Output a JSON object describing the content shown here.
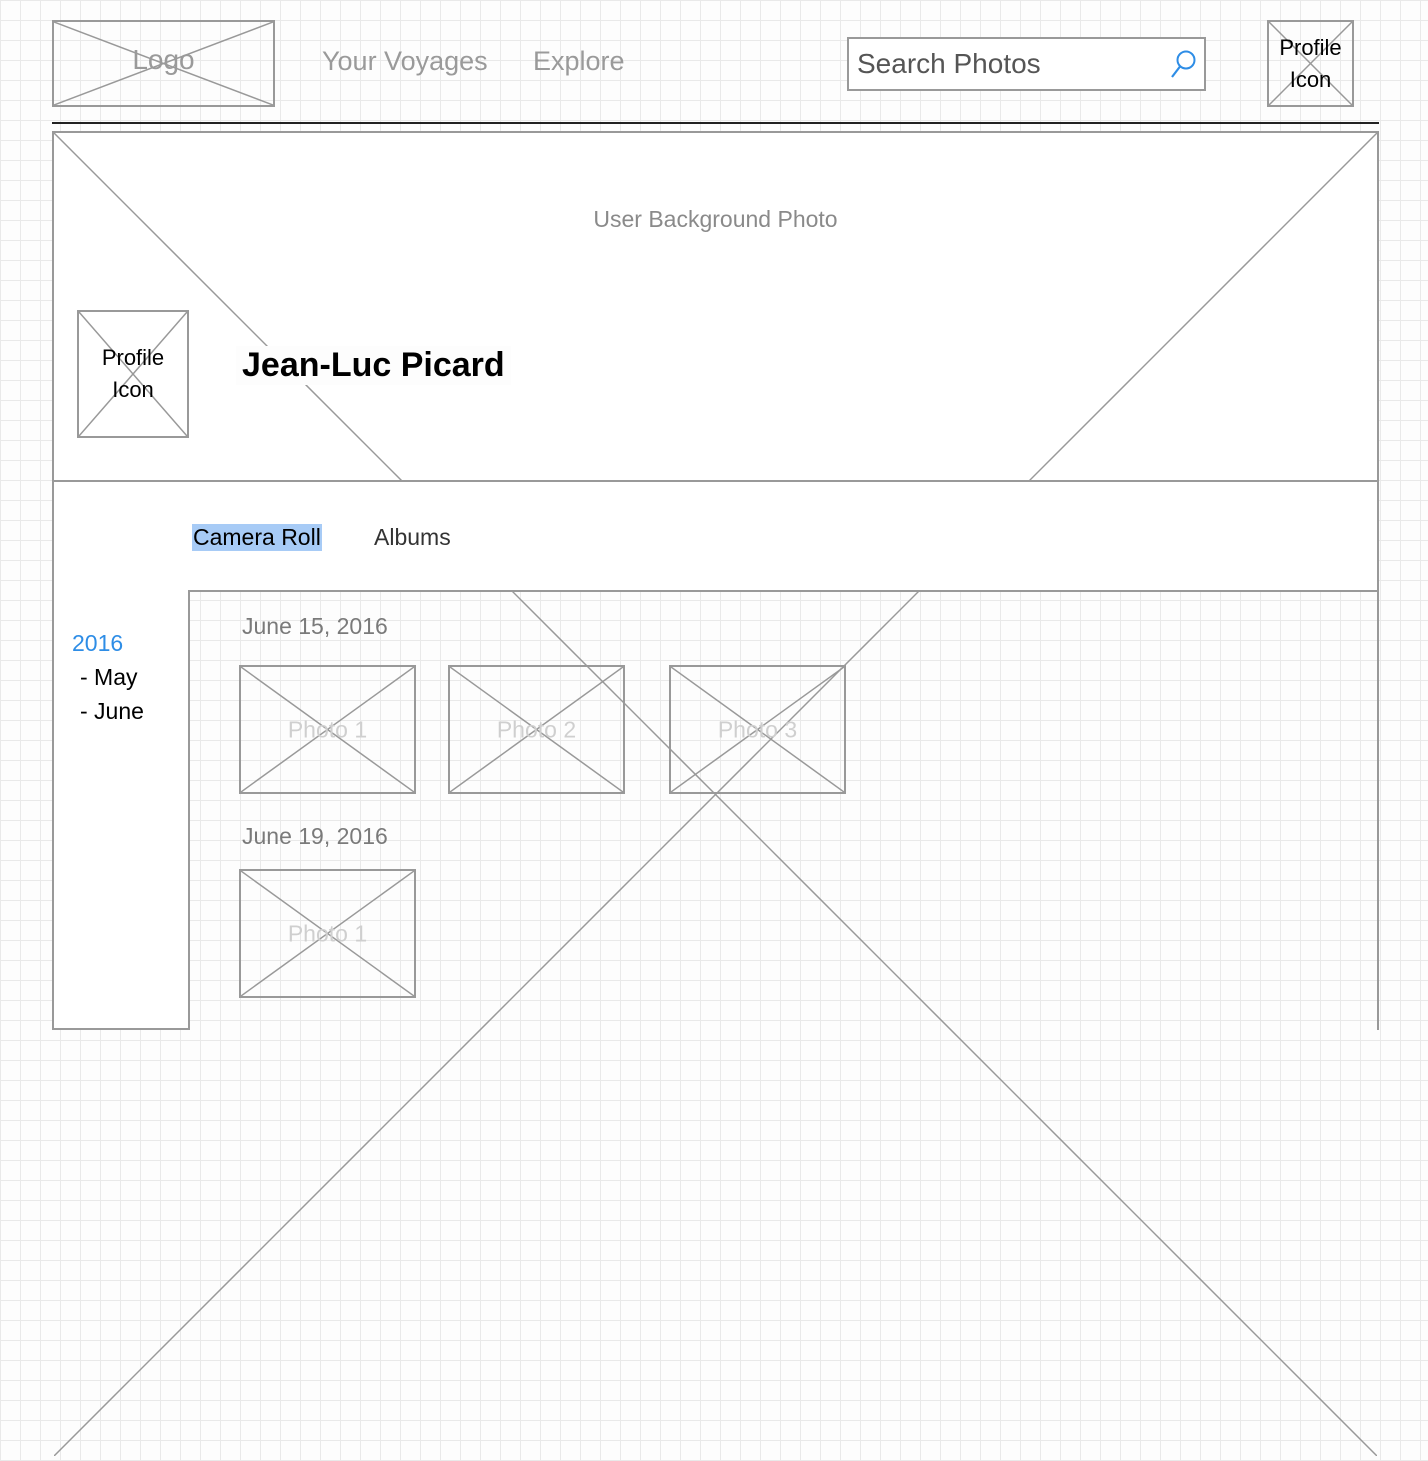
{
  "header": {
    "logo_label": "Logo",
    "nav": [
      "Your Voyages",
      "Explore"
    ],
    "search_placeholder": "Search Photos",
    "profile_label_line1": "Profile",
    "profile_label_line2": "Icon"
  },
  "banner": {
    "background_label": "User Background Photo",
    "profile_label_line1": "Profile",
    "profile_label_line2": "Icon",
    "user_name": "Jean-Luc Picard"
  },
  "tabs": {
    "items": [
      "Camera Roll",
      "Albums"
    ],
    "active": "Camera Roll",
    "highlight_color": "#a7cbf6"
  },
  "sidebar": {
    "year": "2016",
    "months": [
      "- May",
      "- June"
    ],
    "year_color": "#2e8de6"
  },
  "timeline": {
    "groups": [
      {
        "date": "June 15, 2016",
        "photos": [
          "Photo 1",
          "Photo 2",
          "Photo 3"
        ]
      },
      {
        "date": "June 19, 2016",
        "photos": [
          "Photo 1"
        ]
      }
    ]
  },
  "colors": {
    "search_icon": "#2e8de6",
    "wireframe_gray": "#999999"
  }
}
